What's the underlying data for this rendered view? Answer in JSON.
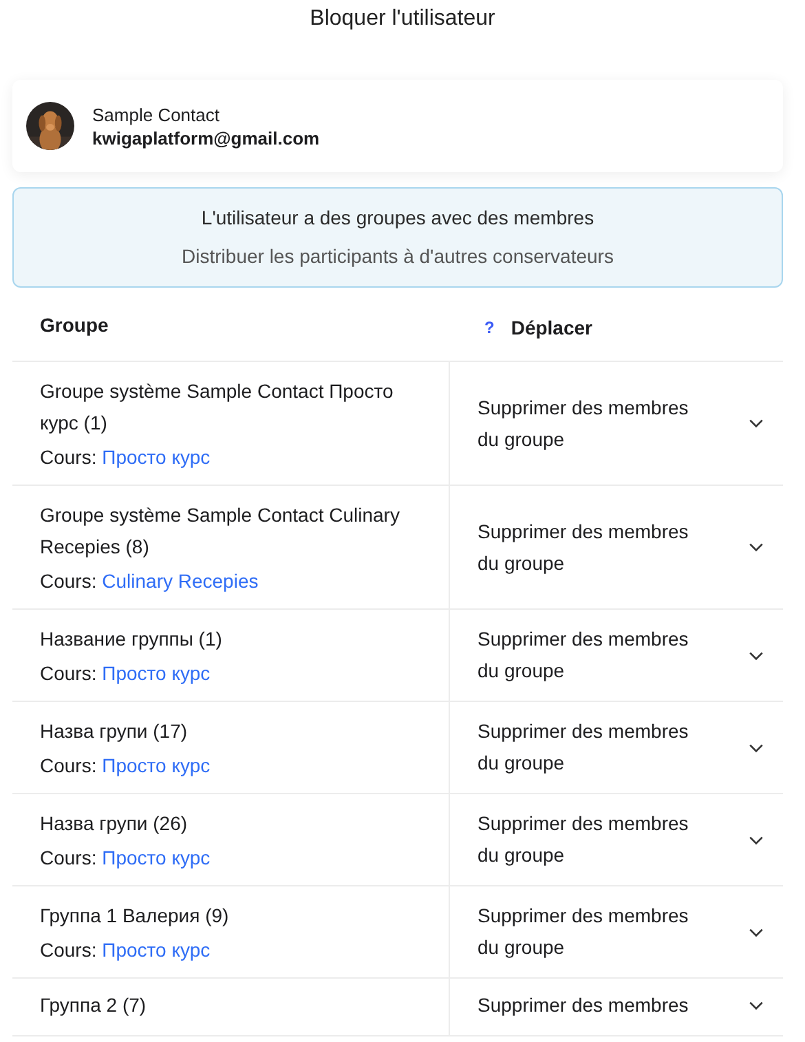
{
  "title": "Bloquer l'utilisateur",
  "contact": {
    "name": "Sample Contact",
    "email": "kwigaplatform@gmail.com"
  },
  "notice": {
    "heading": "L'utilisateur a des groupes avec des membres",
    "text": "Distribuer les participants à d'autres conservateurs"
  },
  "table": {
    "columns": [
      {
        "label": "Groupe"
      },
      {
        "label": "Déplacer",
        "help": "?"
      }
    ],
    "rows": [
      {
        "name": "Groupe système Sample Contact Просто курс (1)",
        "course_label": "Cours:",
        "course": "Просто курс",
        "action": "Supprimer des membres du groupe"
      },
      {
        "name": "Groupe système Sample Contact Culinary Recepies (8)",
        "course_label": "Cours:",
        "course": "Culinary Recepies",
        "action": "Supprimer des membres du groupe"
      },
      {
        "name": "Название группы (1)",
        "course_label": "Cours:",
        "course": "Просто курс",
        "action": "Supprimer des membres du groupe"
      },
      {
        "name": "Назва групи (17)",
        "course_label": "Cours:",
        "course": "Просто курс",
        "action": "Supprimer des membres du groupe"
      },
      {
        "name": "Назва групи (26)",
        "course_label": "Cours:",
        "course": "Просто курс",
        "action": "Supprimer des membres du groupe"
      },
      {
        "name": "Группа 1 Валерия (9)",
        "course_label": "Cours:",
        "course": "Просто курс",
        "action": "Supprimer des membres du groupe"
      },
      {
        "name": "Группа 2 (7)",
        "action": "Supprimer des membres"
      }
    ]
  }
}
